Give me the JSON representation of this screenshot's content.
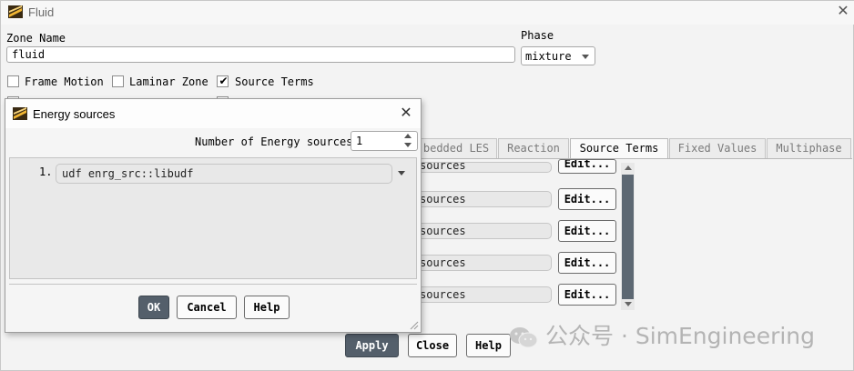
{
  "window": {
    "title": "Fluid",
    "icon": "fluent-logo-icon",
    "close_icon": "close-icon"
  },
  "zone": {
    "label": "Zone Name",
    "value": "fluid"
  },
  "phase": {
    "label": "Phase",
    "value": "mixture"
  },
  "options": [
    {
      "label": "Frame Motion",
      "checked": false
    },
    {
      "label": "Laminar Zone",
      "checked": false
    },
    {
      "label": "Source Terms",
      "checked": true
    }
  ],
  "tabs": [
    {
      "label": "bedded LES",
      "active": false
    },
    {
      "label": "Reaction",
      "active": false
    },
    {
      "label": "Source Terms",
      "active": true
    },
    {
      "label": "Fixed Values",
      "active": false
    },
    {
      "label": "Multiphase",
      "active": false
    }
  ],
  "source_rows": [
    {
      "value": "sources",
      "edit_label": "Edit..."
    },
    {
      "value": "sources",
      "edit_label": "Edit..."
    },
    {
      "value": "sources",
      "edit_label": "Edit..."
    },
    {
      "value": "sources",
      "edit_label": "Edit..."
    },
    {
      "value": "sources",
      "edit_label": "Edit..."
    }
  ],
  "footer": {
    "apply": "Apply",
    "close": "Close",
    "help": "Help"
  },
  "dialog": {
    "title": "Energy sources",
    "count_label": "Number of Energy sources",
    "count_value": "1",
    "entries": [
      {
        "index": "1.",
        "value": "udf enrg_src::libudf"
      }
    ],
    "ok": "OK",
    "cancel": "Cancel",
    "help": "Help"
  },
  "watermark": {
    "text": "公众号 · SimEngineering"
  },
  "colors": {
    "primary_button": "#545f6b",
    "scroll_thumb": "#5d6873",
    "background": "#f0f0f0"
  }
}
